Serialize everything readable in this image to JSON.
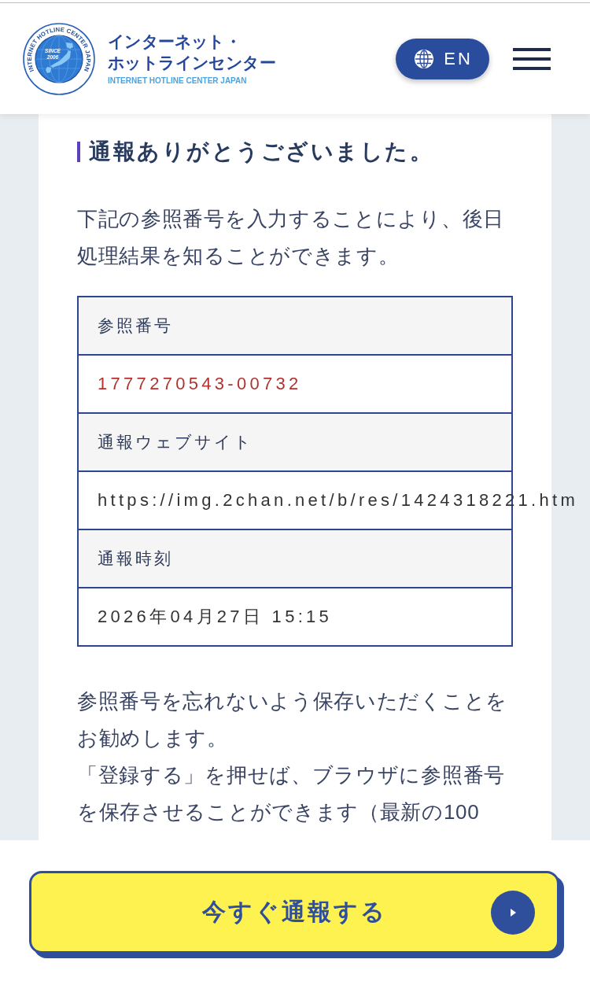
{
  "header": {
    "logo": {
      "ring_text": "INTERNET HOTLINE CENTER JAPAN",
      "since": "SINCE",
      "year": "2006"
    },
    "title_lines": [
      "インターネット・",
      "ホットラインセンター"
    ],
    "subtitle": "INTERNET HOTLINE CENTER JAPAN",
    "language_button": {
      "label": "EN"
    }
  },
  "content": {
    "heading": "通報ありがとうございました。",
    "intro": "下記の参照番号を入力することにより、後日処理結果を知ることができます。",
    "details": [
      {
        "label": "参照番号",
        "value": "1777270543-00732",
        "highlighted": true
      },
      {
        "label": "通報ウェブサイト",
        "value": "https://img.2chan.net/b/res/1424318221.htm",
        "highlighted": false
      },
      {
        "label": "通報時刻",
        "value": "2026年04月27日 15:15",
        "highlighted": false
      }
    ],
    "notes": [
      "参照番号を忘れないよう保存いただくことをお勧めします。",
      "「登録する」を押せば、ブラウザに参照番号を保存させることができます（最新の100"
    ]
  },
  "footer": {
    "report_button": {
      "label": "今すぐ通報する"
    }
  }
}
